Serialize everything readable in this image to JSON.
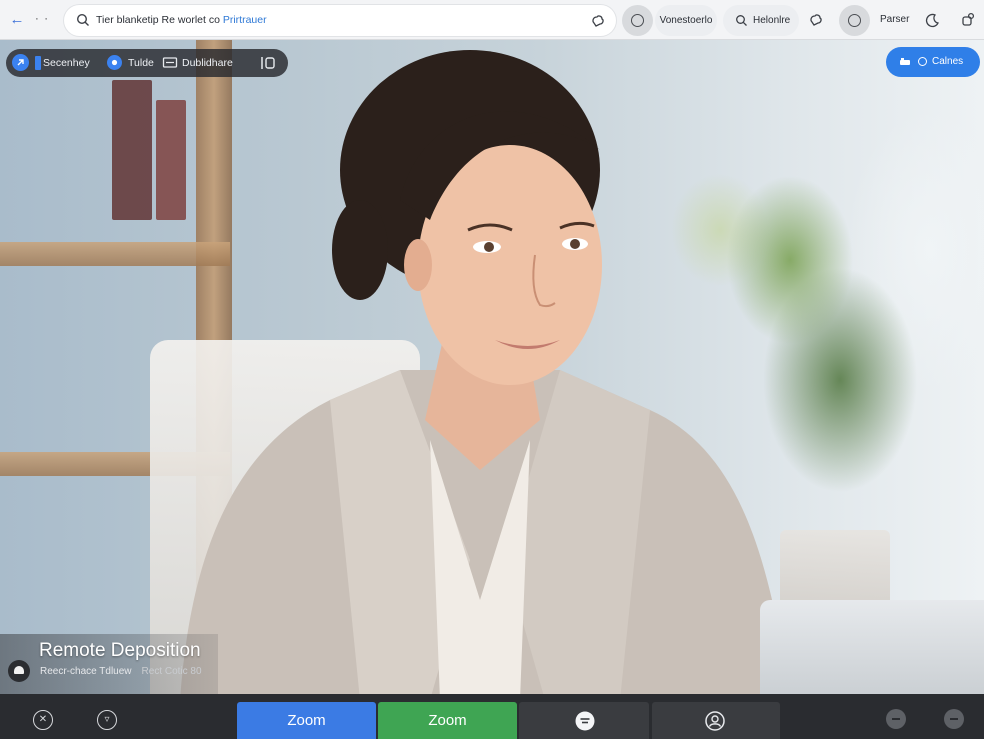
{
  "browser": {
    "address_text": "Tier blanketip Re worlet co",
    "address_link": "Prirtrauer",
    "pill_1": "Vonestoerlo",
    "pill_2": "Helonlre",
    "label_3": "Parser"
  },
  "meeting_bar": {
    "item_1": "Secenhey",
    "item_2": "Tulde",
    "item_3": "Dublidhare"
  },
  "top_button": {
    "label": "Calnes"
  },
  "participant": {
    "title": "Remote Deposition",
    "subtitle": "Reecr-chace Tdluew",
    "subtitle_extra": "Rect Cotic 80"
  },
  "controls": {
    "zoom_blue": "Zoom",
    "zoom_green": "Zoom"
  },
  "colors": {
    "accent_blue": "#2f7fe8",
    "zoom_blue": "#3b7be4",
    "zoom_green": "#3fa553",
    "control_bar": "#2a2c30"
  }
}
